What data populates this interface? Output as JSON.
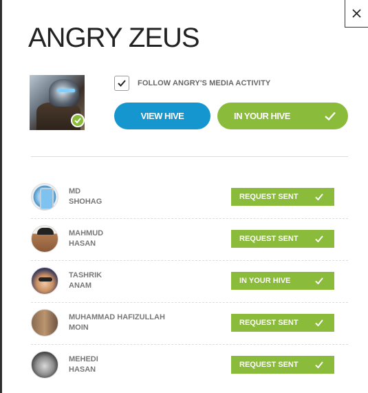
{
  "title": "ANGRY ZEUS",
  "follow_label": "FOLLOW ANGRY'S MEDIA ACTIVITY",
  "follow_checked": true,
  "buttons": {
    "view_hive": "VIEW HIVE",
    "in_your_hive": "IN YOUR HIVE"
  },
  "colors": {
    "blue": "#1596cf",
    "green": "#8bbb3b",
    "text": "#222222",
    "muted": "#777777"
  },
  "icons": {
    "close": "close-icon",
    "check": "check-icon"
  },
  "members": [
    {
      "first": "MD",
      "last": "SHOHAG",
      "status": "REQUEST SENT"
    },
    {
      "first": "MAHMUD",
      "last": "HASAN",
      "status": "REQUEST SENT"
    },
    {
      "first": "TASHRIK",
      "last": "ANAM",
      "status": "IN YOUR HIVE"
    },
    {
      "first": "MUHAMMAD HAFIZULLAH",
      "last": "MOIN",
      "status": "REQUEST SENT"
    },
    {
      "first": "MEHEDI",
      "last": "HASAN",
      "status": "REQUEST SENT"
    }
  ]
}
